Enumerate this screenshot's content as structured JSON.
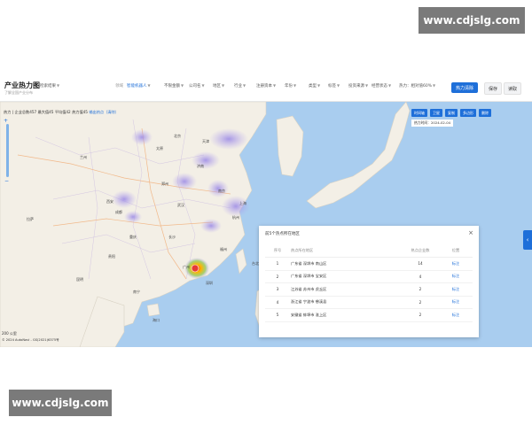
{
  "watermark_top": "www.cdjslg.com",
  "watermark_bottom": "www.cdjslg.com",
  "app": {
    "title": "产业热力图",
    "subtitle": "了解全国产业分布",
    "filter_first": "检索结果",
    "filters": [
      {
        "label": "领域",
        "value": "智能机器人",
        "active": true
      },
      {
        "label": "",
        "value": "不限金额",
        "active": false
      },
      {
        "label": "",
        "value": "公司名",
        "active": false
      },
      {
        "label": "",
        "value": "地区",
        "active": false
      },
      {
        "label": "",
        "value": "行业",
        "active": false
      },
      {
        "label": "",
        "value": "注册资本",
        "active": false
      },
      {
        "label": "",
        "value": "年份",
        "active": false
      },
      {
        "label": "",
        "value": "类型",
        "active": false
      },
      {
        "label": "",
        "value": "标签",
        "active": false
      },
      {
        "label": "",
        "value": "投资来源",
        "active": false
      },
      {
        "label": "",
        "value": "经营状态",
        "active": false
      },
      {
        "label": "",
        "value": "热力：相对值60%",
        "active": false
      }
    ],
    "buttons": {
      "primary": "热力清除",
      "save": "保存",
      "read": "读取"
    }
  },
  "map": {
    "stats": {
      "heat": "热力",
      "company_total": "企业总数457",
      "max": "最大值45",
      "average": "平均值42",
      "heat_value": "热力值45",
      "link": "输出热点（清除）"
    },
    "tools": [
      "时间轴",
      "卫星",
      "复制",
      "多边形",
      "删除"
    ],
    "time": "热力时间：2024-02-04",
    "scale": "200 公里",
    "attribution": "© 2024 AutoNavi - GS(2021)6375号",
    "side_tab_icon": "chevron-left",
    "city_labels": [
      "北京",
      "天津",
      "西安",
      "成都",
      "重庆",
      "武汉",
      "南京",
      "上海",
      "杭州",
      "长沙",
      "广州",
      "深圳",
      "福州",
      "郑州",
      "昆明",
      "贵阳",
      "南宁",
      "海口",
      "拉萨",
      "兰州",
      "太原",
      "济南",
      "台北"
    ]
  },
  "panel": {
    "title": "前5个热点所在地区",
    "close_icon": "close-icon",
    "columns": [
      "序号",
      "热点所在地区",
      "热点企业数",
      "位置"
    ],
    "rows": [
      {
        "idx": "1",
        "region": "广东省 深圳市 南山区",
        "count": "14",
        "pos": "标注"
      },
      {
        "idx": "2",
        "region": "广东省 深圳市 宝安区",
        "count": "4",
        "pos": "标注"
      },
      {
        "idx": "3",
        "region": "江苏省 苏州市 虎丘区",
        "count": "2",
        "pos": "标注"
      },
      {
        "idx": "4",
        "region": "浙江省 宁波市 慈溪县",
        "count": "2",
        "pos": "标注"
      },
      {
        "idx": "5",
        "region": "安徽省 蚌埠市 淮上区",
        "count": "2",
        "pos": "标注"
      }
    ]
  },
  "colors": {
    "accent": "#1e6fd9",
    "land": "#f3efe6",
    "sea": "#a9cdef",
    "heat": "#b7a8ee"
  }
}
